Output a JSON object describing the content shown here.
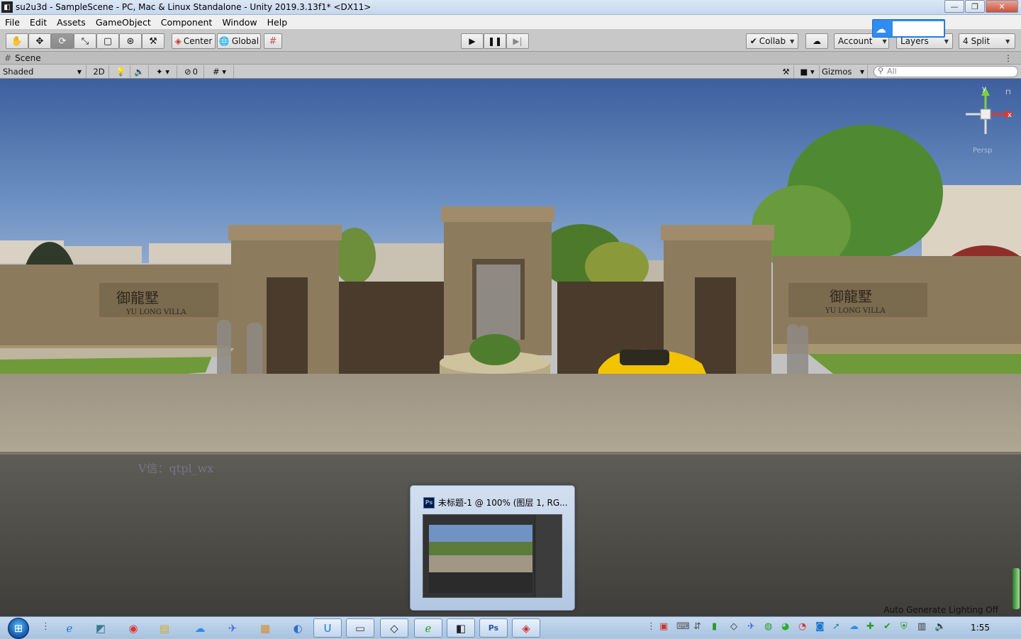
{
  "window": {
    "title": "su2u3d - SampleScene - PC, Mac & Linux Standalone - Unity 2019.3.13f1* <DX11>",
    "minimize": "—",
    "maximize": "❐",
    "close": "✕"
  },
  "menu": [
    "File",
    "Edit",
    "Assets",
    "GameObject",
    "Component",
    "Window",
    "Help"
  ],
  "toolbar": {
    "pivot_label": "Center",
    "space_label": "Global",
    "collab_label": "Collab",
    "account_label": "Account",
    "layers_label": "Layers",
    "layout_label": "4 Split"
  },
  "scene_tab": {
    "label": "Scene"
  },
  "scene_toolbar": {
    "draw_mode": "Shaded",
    "mode_2d": "2D",
    "hidden_count": "0",
    "gizmos_label": "Gizmos",
    "search_placeholder": "All"
  },
  "scene": {
    "watermark": "V信：qtpl_wx",
    "status": "Auto Generate Lighting Off",
    "gizmo_axes": [
      "y",
      "x"
    ],
    "gizmo_label": "Persp"
  },
  "ps_popup": {
    "icon": "Ps",
    "title": "未标题-1 @ 100% (图层 1, RG..."
  },
  "taskbar": {
    "clock": "1:55"
  },
  "colors": {
    "sky_top": "#3d5f9e",
    "ground": "#b1a893",
    "wall": "#8c7a5c",
    "gate": "#4a3b2c",
    "car": "#f2c400",
    "taskbar": "#a7c2e0"
  }
}
